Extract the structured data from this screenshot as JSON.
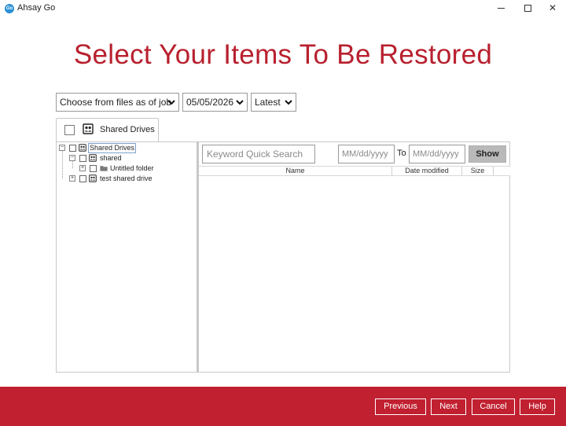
{
  "window": {
    "logo_text": "Go",
    "title": "Ahsay Go",
    "controls": [
      "minimize",
      "maximize",
      "close"
    ]
  },
  "heading": "Select Your Items To Be Restored",
  "filters": {
    "job_select": "Choose from files as of job",
    "date_select": "05/05/2026",
    "version_select": "Latest"
  },
  "tab": {
    "label": "Shared Drives",
    "icon": "shared-drive-icon"
  },
  "tree": {
    "root": {
      "label": "Shared Drives",
      "expanded": true
    },
    "items": [
      {
        "label": "shared",
        "expanded": true,
        "icon": "shared-drive-icon"
      },
      {
        "label": "Untitled folder",
        "expanded": false,
        "icon": "folder-icon"
      },
      {
        "label": "test shared drive",
        "expanded": false,
        "icon": "shared-drive-icon"
      }
    ]
  },
  "search": {
    "placeholder": "Keyword Quick Search",
    "from_placeholder": "MM/dd/yyyy",
    "to_label": "To",
    "to_placeholder": "MM/dd/yyyy",
    "show_label": "Show"
  },
  "table": {
    "columns": [
      "Name",
      "Date modified",
      "Size"
    ]
  },
  "footer": {
    "previous": "Previous",
    "next": "Next",
    "cancel": "Cancel",
    "help": "Help"
  },
  "colors": {
    "accent": "#c12030",
    "heading": "#b8202e",
    "logo": "#2a8fd6"
  }
}
